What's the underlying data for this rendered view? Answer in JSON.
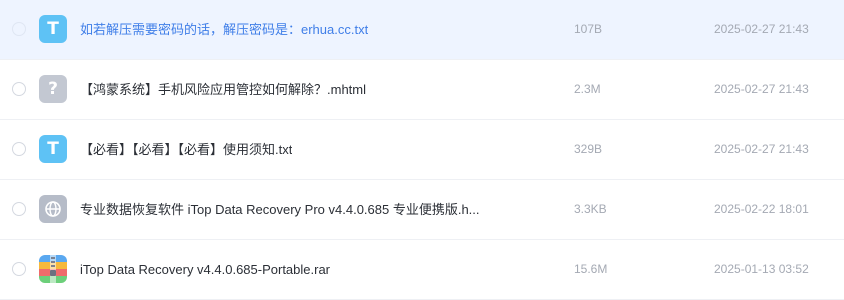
{
  "file_list": {
    "rows": [
      {
        "name": "如若解压需要密码的话，解压密码是：erhua.cc.txt",
        "size": "107B",
        "date": "2025-02-27 21:43",
        "icon": "txt-file-icon",
        "icon_glyph": "T",
        "selected": true
      },
      {
        "name": "【鸿蒙系统】手机风险应用管控如何解除？.mhtml",
        "size": "2.3M",
        "date": "2025-02-27 21:43",
        "icon": "unknown-file-icon",
        "icon_glyph": "?",
        "selected": false
      },
      {
        "name": "【必看】【必看】【必看】使用须知.txt",
        "size": "329B",
        "date": "2025-02-27 21:43",
        "icon": "txt-file-icon",
        "icon_glyph": "T",
        "selected": false
      },
      {
        "name": "专业数据恢复软件 iTop Data Recovery Pro v4.4.0.685 专业便携版.h...",
        "size": "3.3KB",
        "date": "2025-02-22 18:01",
        "icon": "web-file-icon",
        "selected": false
      },
      {
        "name": "iTop Data Recovery v4.4.0.685-Portable.rar",
        "size": "15.6M",
        "date": "2025-01-13 03:52",
        "icon": "archive-file-icon",
        "selected": false
      }
    ]
  },
  "colors": {
    "selected_row_bg": "#eef4ff",
    "selected_text": "#3f7ee8",
    "txt_icon": "#5ec2f5",
    "unknown_icon": "#c3c8d2",
    "web_icon": "#b6bcc8"
  }
}
